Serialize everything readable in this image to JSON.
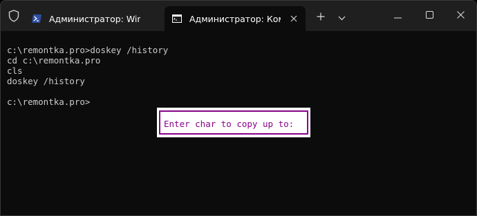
{
  "tabs": [
    {
      "title": "Администратор: Windows PowerShell",
      "icon": "powershell-icon"
    },
    {
      "title": "Администратор: Командная строка",
      "icon": "cmd-icon"
    }
  ],
  "titlebar": {
    "shield_icon": "shield-icon",
    "new_tab_icon": "plus-icon",
    "dropdown_icon": "chevron-down-icon",
    "minimize_icon": "minimize-icon",
    "maximize_icon": "maximize-icon",
    "close_icon": "close-icon"
  },
  "console": {
    "lines": [
      "c:\\remontka.pro>doskey /history",
      "cd c:\\remontka.pro",
      "cls",
      "doskey /history",
      "",
      "c:\\remontka.pro>"
    ]
  },
  "popup": {
    "prompt": "Enter char to copy up to: "
  },
  "colors": {
    "titlebar_bg": "#1f1f1f",
    "console_bg": "#0c0c0c",
    "console_text": "#cccccc",
    "popup_accent": "#880088",
    "popup_bg": "#ffffff",
    "powershell_blue": "#2d4fa6"
  }
}
